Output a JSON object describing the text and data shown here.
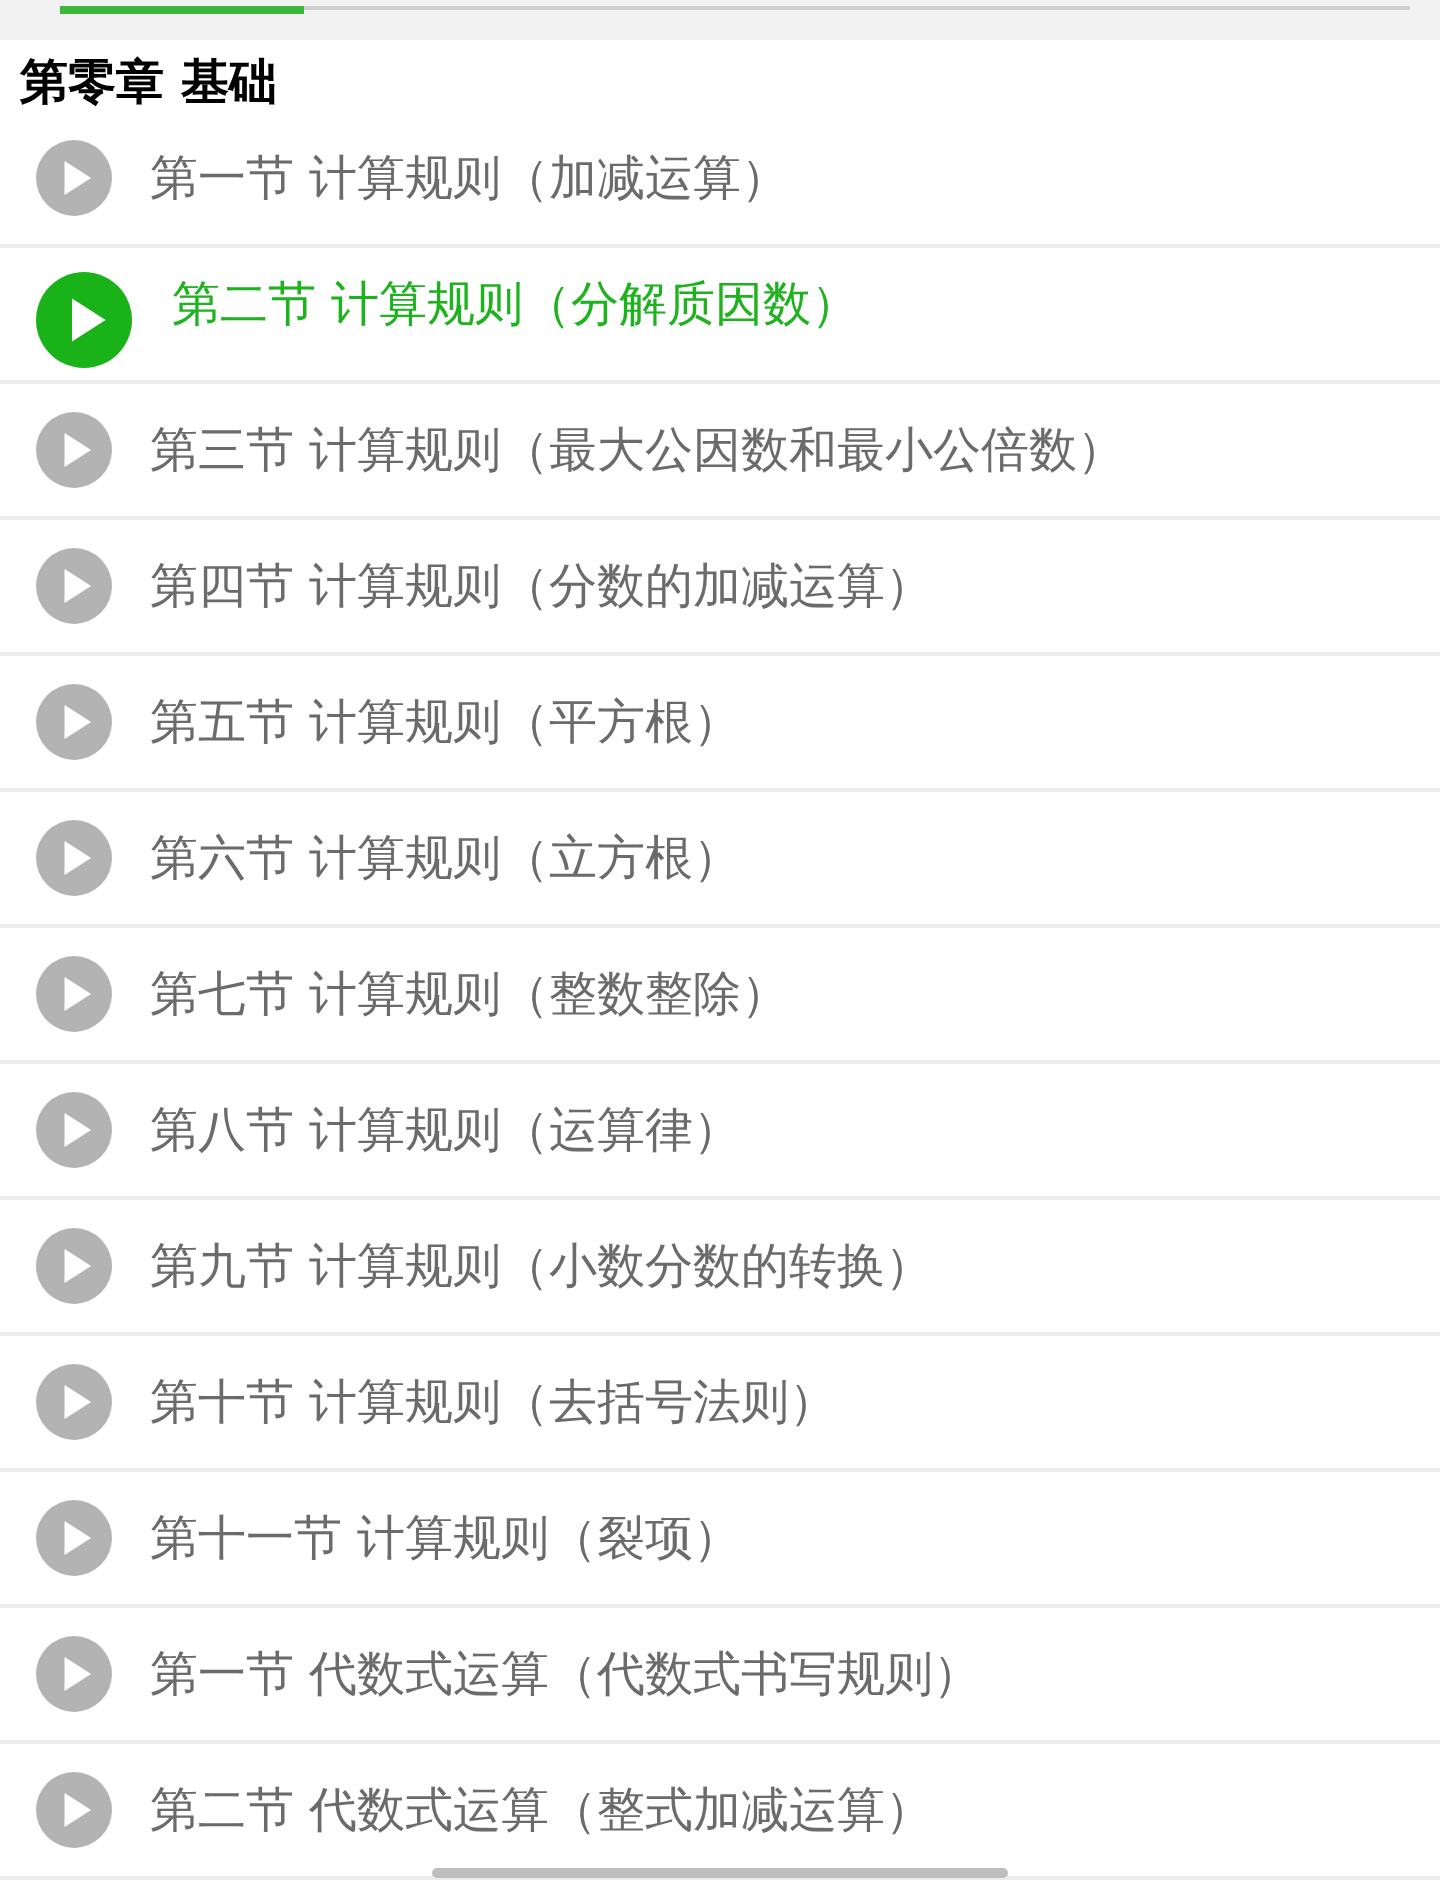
{
  "progress": {
    "level": 0.18
  },
  "chapter": {
    "title": "第零章 基础"
  },
  "lessons": [
    {
      "title": "第一节 计算规则（加减运算）",
      "selected": false
    },
    {
      "title": "第二节 计算规则（分解质因数）",
      "selected": true
    },
    {
      "title": "第三节 计算规则（最大公因数和最小公倍数）",
      "selected": false
    },
    {
      "title": "第四节 计算规则（分数的加减运算）",
      "selected": false
    },
    {
      "title": "第五节 计算规则（平方根）",
      "selected": false
    },
    {
      "title": "第六节 计算规则（立方根）",
      "selected": false
    },
    {
      "title": "第七节 计算规则（整数整除）",
      "selected": false
    },
    {
      "title": "第八节 计算规则（运算律）",
      "selected": false
    },
    {
      "title": "第九节 计算规则（小数分数的转换）",
      "selected": false
    },
    {
      "title": "第十节 计算规则（去括号法则）",
      "selected": false
    },
    {
      "title": "第十一节 计算规则（裂项）",
      "selected": false
    },
    {
      "title": "第一节 代数式运算（代数式书写规则）",
      "selected": false
    },
    {
      "title": "第二节 代数式运算（整式加减运算）",
      "selected": false
    }
  ]
}
